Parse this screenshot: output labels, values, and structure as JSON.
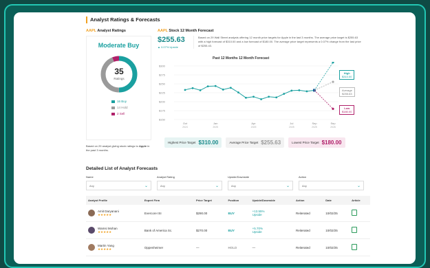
{
  "section_title": "Analyst Ratings & Forecasts",
  "ratings": {
    "subtitle_ticker": "AAPL",
    "subtitle_text": "Analyst Ratings",
    "consensus": "Moderate Buy",
    "total": "35",
    "total_label": "Ratings",
    "buy_label": "16 Buy",
    "hold_label": "14 Hold",
    "sell_label": "2 Sell",
    "buy_count": 16,
    "hold_count": 14,
    "sell_count": 2,
    "note_pre": "Based on 29 analyst giving stock ratings to ",
    "note_ticker": "Apple",
    "note_post": " in the past 3 months."
  },
  "forecast": {
    "subtitle_ticker": "AAPL",
    "subtitle_text": "Stock 12 Month Forecast",
    "price": "$255.63",
    "change": "▲ 0.07% Upside",
    "description": "Based on 29 Wall Street analysts offering 12 month price targets for Apple in the last 3 months. The average price target is $255.63 with a high forecast of $310.00 and a low forecast of $180.00. The average price target represents a 0.07% change from the last price of $255.43.",
    "chart_title": "Past 12 Months 12 Month Forecast",
    "high_label": "High",
    "high_value": "$310.00",
    "avg_label": "Average",
    "avg_value": "$255.63",
    "low_label": "Low",
    "low_value": "$180.00",
    "highest_label": "Highest Price Target",
    "highest_value": "$310.00",
    "average_label": "Average Price Target",
    "average_value": "$255.63",
    "lowest_label": "Lowest Price Target",
    "lowest_value": "$180.00"
  },
  "chart_data": {
    "type": "line",
    "yticks": [
      "$300",
      "$275",
      "$250",
      "$225",
      "$200",
      "$175",
      "$150"
    ],
    "ylim": [
      150,
      300
    ],
    "xticks": [
      {
        "m": "Oct",
        "y": "2024"
      },
      {
        "m": "Jan",
        "y": "2025"
      },
      {
        "m": "Apr",
        "y": "2025"
      },
      {
        "m": "Jul",
        "y": "2025"
      },
      {
        "m": "Sep",
        "y": "2025"
      },
      {
        "m": "Sep",
        "y": "2026"
      }
    ],
    "series": [
      {
        "values": [
          233,
          238,
          232,
          243,
          244,
          234,
          239,
          226,
          211,
          214,
          207,
          214,
          212,
          222,
          231,
          232,
          229,
          232
        ]
      }
    ],
    "forecast": {
      "from": 232,
      "high": 310,
      "average": 255.63,
      "low": 180
    }
  },
  "details": {
    "title": "Detailed List of Analyst Forecasts",
    "filters": [
      {
        "label": "Name",
        "value": "Any"
      },
      {
        "label": "Analyst Rating",
        "value": "Any"
      },
      {
        "label": "Upside/Downside",
        "value": "Any"
      },
      {
        "label": "Action",
        "value": "Any"
      }
    ],
    "columns": [
      "Analyst Profile",
      "Expert Firm",
      "Price Target",
      "Position",
      "Upside/Downside",
      "Action",
      "Date",
      "Article"
    ],
    "rows": [
      {
        "name": "Amit Daryanani",
        "stars": "★★★★★",
        "firm": "Evercore ISI",
        "target": "$290.00",
        "position": "BUY",
        "updown1": "+13.55%",
        "updown2": "Upside",
        "action": "Reiterated",
        "date": "10/02/25"
      },
      {
        "name": "Wamsi Mohan",
        "stars": "★★★★★",
        "firm": "Bank of America Sc.",
        "target": "$270.00",
        "position": "BUY",
        "updown1": "+5.70%",
        "updown2": "Upside",
        "action": "Reiterated",
        "date": "10/02/25"
      },
      {
        "name": "Martin Yang",
        "stars": "★★★★★",
        "firm": "Oppenheimer",
        "target": "—",
        "position": "HOLD",
        "updown1": "—",
        "updown2": "",
        "action": "Reiterated",
        "date": "10/02/25"
      }
    ]
  },
  "colors": {
    "teal": "#1aa0a0",
    "buy": "#1aa0a0",
    "hold": "#9a9a9a",
    "sell": "#b0206a",
    "accent": "#f0a020"
  }
}
